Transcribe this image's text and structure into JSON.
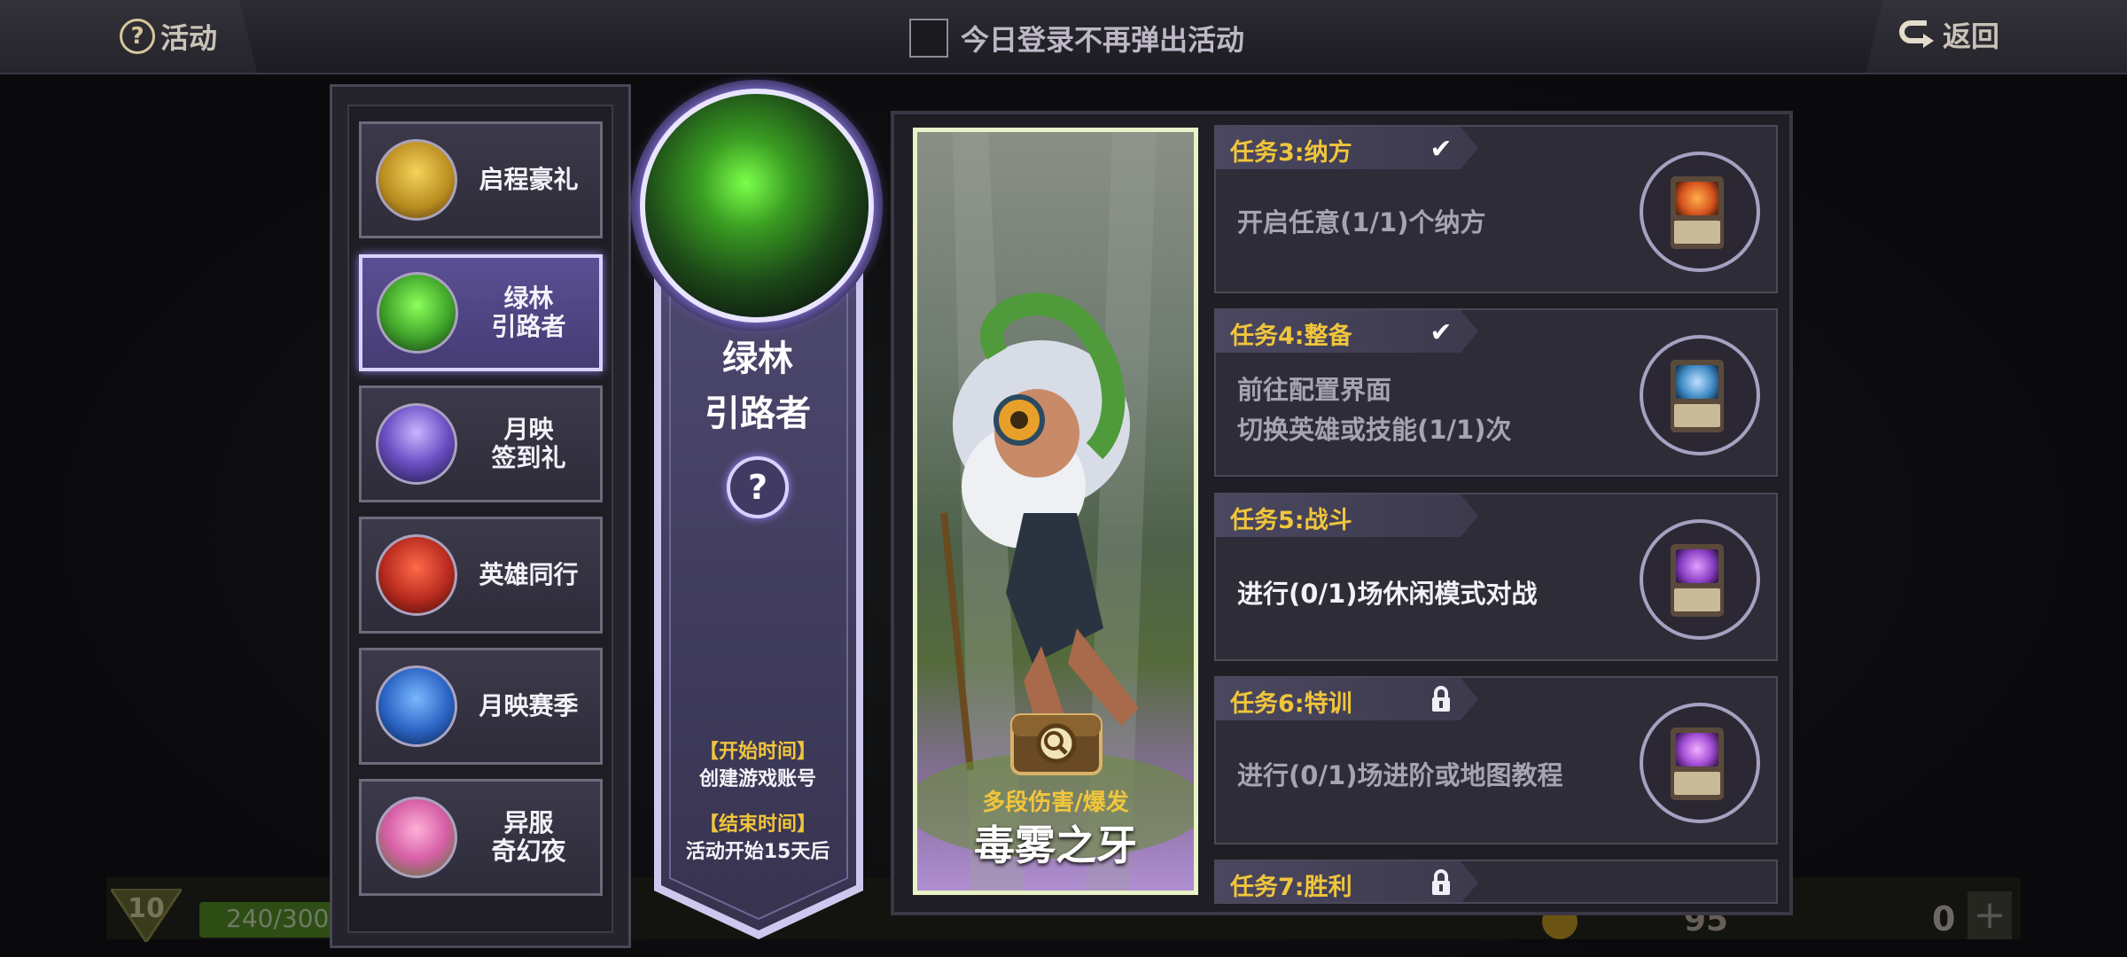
{
  "topbar": {
    "help_label": "活动",
    "toggle_label": "今日登录不再弹出活动",
    "back_label": "返回"
  },
  "background": {
    "level": "10",
    "xp": "240/300",
    "coins": "95",
    "gems": "0"
  },
  "activities": [
    {
      "label": "启程豪礼",
      "icon": "golden-staff-icon",
      "color": "#b78a1e"
    },
    {
      "label": "绿林\n引路者",
      "icon": "green-ranger-icon",
      "color": "#3fa32a",
      "active": true
    },
    {
      "label": "月映\n签到礼",
      "icon": "purple-moon-icon",
      "color": "#6b4fc4"
    },
    {
      "label": "英雄同行",
      "icon": "red-heroes-icon",
      "color": "#b72a1e"
    },
    {
      "label": "月映赛季",
      "icon": "blue-wolf-icon",
      "color": "#2a64c4"
    },
    {
      "label": "异服\n奇幻夜",
      "icon": "pink-clown-icon",
      "color": "#d65fa6"
    }
  ],
  "banner": {
    "title_line1": "绿林",
    "title_line2": "引路者",
    "start_label": "【开始时间】",
    "start_value": "创建游戏账号",
    "end_label": "【结束时间】",
    "end_value": "活动开始15天后"
  },
  "hero": {
    "type": "多段伤害/爆发",
    "name": "毒雾之牙"
  },
  "tasks": [
    {
      "title": "任务3:纳方",
      "status": "✔",
      "status_icon": "checkmark-icon",
      "desc": "开启任意(1/1)个纳方",
      "bright": false,
      "reward_color": "#d6521e"
    },
    {
      "title": "任务4:整备",
      "status": "✔",
      "status_icon": "checkmark-icon",
      "desc": "前往配置界面\n切换英雄或技能(1/1)次",
      "bright": false,
      "reward_color": "#3f8ac4"
    },
    {
      "title": "任务5:战斗",
      "status": "",
      "status_icon": "",
      "desc": "进行(0/1)场休闲模式对战",
      "bright": true,
      "reward_color": "#8a3fc4"
    },
    {
      "title": "任务6:特训",
      "status": "🔒",
      "status_icon": "lock-icon",
      "desc": "进行(0/1)场进阶或地图教程",
      "bright": false,
      "reward_color": "#a44fd6"
    },
    {
      "title": "任务7:胜利",
      "status": "🔒",
      "status_icon": "lock-icon",
      "desc": "",
      "bright": false,
      "reward_color": "#6a6a80"
    }
  ]
}
